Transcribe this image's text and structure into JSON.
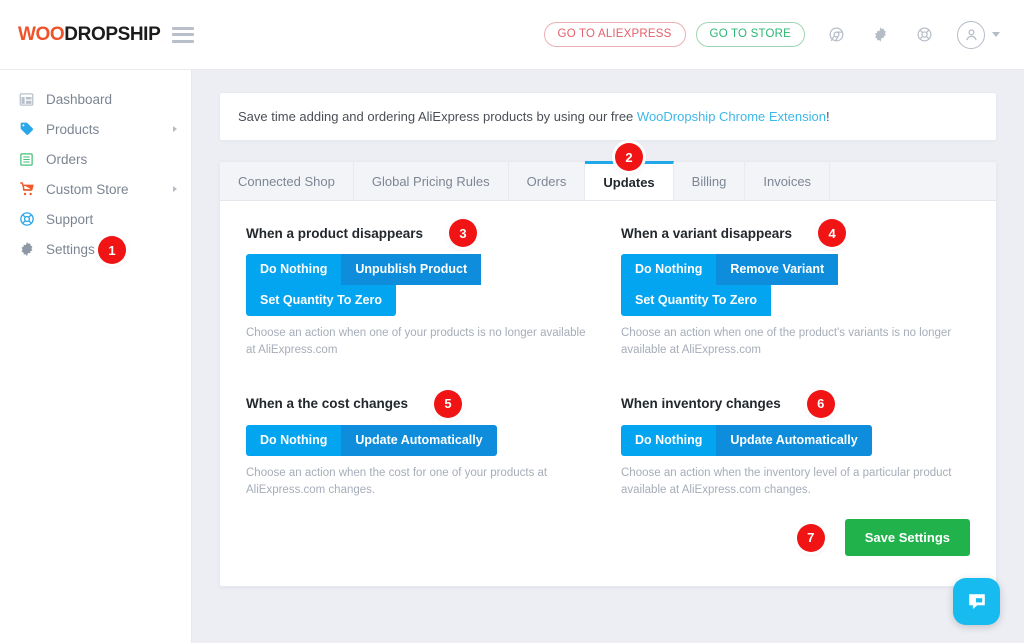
{
  "brand": {
    "name_prefix": "WOO",
    "name_suffix": "DROPSHIP",
    "accent_color": "#f0522a"
  },
  "topbar": {
    "menu_icon": "hamburger-icon",
    "aliexpress_button": "GO TO ALIEXPRESS",
    "store_button": "GO TO STORE",
    "icons": [
      "chrome-icon",
      "gear-icon",
      "lifebuoy-icon",
      "user-avatar-icon"
    ]
  },
  "sidebar": {
    "items": [
      {
        "label": "Dashboard",
        "icon": "dashboard-icon",
        "has_arrow": false,
        "badge": null
      },
      {
        "label": "Products",
        "icon": "tag-icon",
        "has_arrow": true,
        "badge": null
      },
      {
        "label": "Orders",
        "icon": "list-icon",
        "has_arrow": false,
        "badge": null
      },
      {
        "label": "Custom Store",
        "icon": "cart-icon",
        "has_arrow": true,
        "badge": null
      },
      {
        "label": "Support",
        "icon": "lifebuoy-icon",
        "has_arrow": false,
        "badge": null
      },
      {
        "label": "Settings",
        "icon": "gear-icon",
        "has_arrow": false,
        "badge": "1"
      }
    ]
  },
  "notice": {
    "text_before": "Save time adding and ordering AliExpress products by using our free ",
    "link": "WooDropship Chrome Extension",
    "text_after": "!"
  },
  "tabs": [
    {
      "label": "Connected Shop",
      "active": false
    },
    {
      "label": "Global Pricing Rules",
      "active": false
    },
    {
      "label": "Orders",
      "active": false
    },
    {
      "label": "Updates",
      "active": true,
      "badge": "2"
    },
    {
      "label": "Billing",
      "active": false
    },
    {
      "label": "Invoices",
      "active": false
    }
  ],
  "settings": [
    {
      "title": "When a product disappears",
      "badge": "3",
      "options": [
        {
          "label": "Do Nothing",
          "selected": true
        },
        {
          "label": "Unpublish Product",
          "selected": false
        },
        {
          "label": "Set Quantity To Zero",
          "selected": true
        }
      ],
      "helper": "Choose an action when one of your products is no longer available at AliExpress.com"
    },
    {
      "title": "When a variant disappears",
      "badge": "4",
      "options": [
        {
          "label": "Do Nothing",
          "selected": true
        },
        {
          "label": "Remove Variant",
          "selected": false
        },
        {
          "label": "Set Quantity To Zero",
          "selected": true
        }
      ],
      "helper": "Choose an action when one of the product's variants is no longer available at AliExpress.com"
    },
    {
      "title": "When a the cost changes",
      "badge": "5",
      "options": [
        {
          "label": "Do Nothing",
          "selected": true
        },
        {
          "label": "Update Automatically",
          "selected": false
        }
      ],
      "helper": "Choose an action when the cost for one of your products at AliExpress.com changes."
    },
    {
      "title": "When inventory changes",
      "badge": "6",
      "options": [
        {
          "label": "Do Nothing",
          "selected": true
        },
        {
          "label": "Update Automatically",
          "selected": false
        }
      ],
      "helper": "Choose an action when the inventory level of a particular product available at AliExpress.com changes."
    }
  ],
  "footer": {
    "save_label": "Save Settings",
    "save_badge": "7",
    "save_color": "#21b24b"
  },
  "chat": {
    "icon": "chat-bubble-icon",
    "color": "#18bbf0"
  },
  "colors": {
    "option_selected": "#03a4f0",
    "option_default": "#0d8ddb",
    "badge_red": "#f01414",
    "tab_active_border": "#1fa7e8",
    "link_blue": "#3db8e8"
  }
}
